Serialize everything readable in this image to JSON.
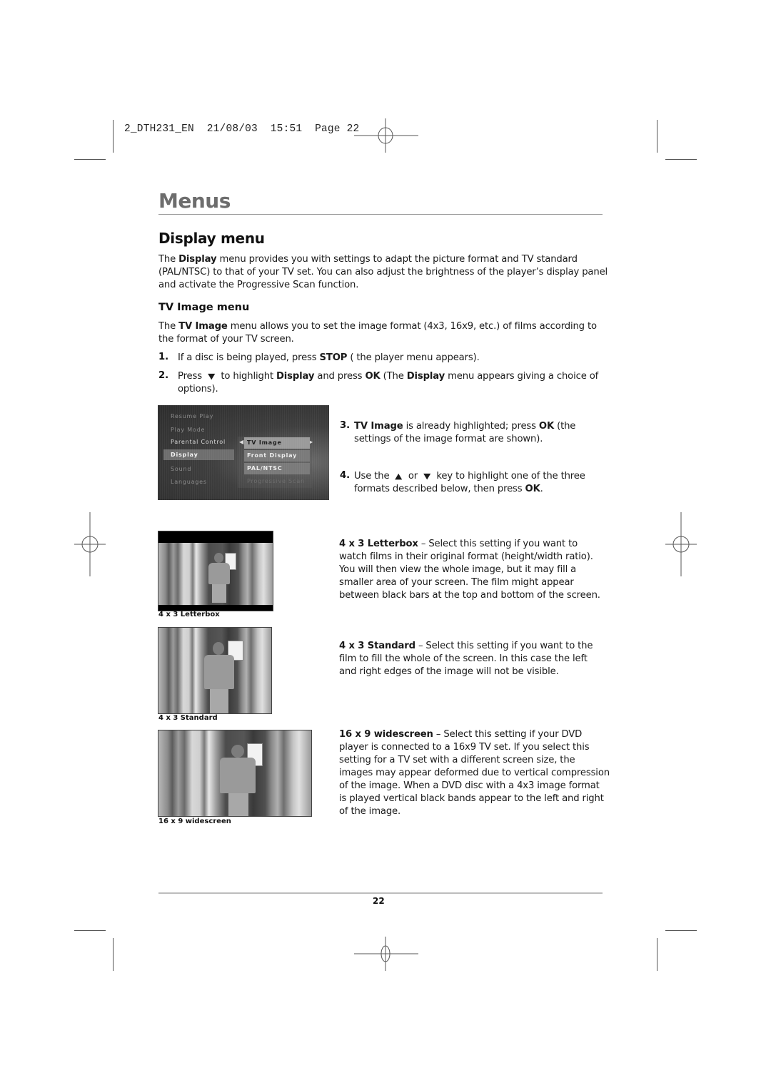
{
  "slug": {
    "file": "2_DTH231_EN",
    "date": "21/08/03",
    "time": "15:51",
    "page_label": "Page 22"
  },
  "chapter_title": "Menus",
  "section_title": "Display menu",
  "intro": {
    "pre": "The ",
    "bold": "Display",
    "line1_rest": " menu provides you with settings to adapt the picture format and TV standard",
    "line2": "(PAL/NTSC) to that of your TV set. You can also adjust the brightness of the player’s display panel",
    "line3": "and activate the Progressive Scan function."
  },
  "subsection_title": "TV Image menu",
  "tv_image_intro": {
    "pre": "The ",
    "bold": "TV Image",
    "line1_rest": " menu allows you to set the image format (4x3, 16x9, etc.) of films according to",
    "line2": "the format of your TV screen."
  },
  "steps": [
    {
      "num": "1.",
      "parts": [
        "If a disc is being played, press ",
        "STOP",
        " ( the player menu appears)."
      ]
    },
    {
      "num": "2.",
      "parts": [
        "Press ",
        "⮟",
        " to highlight ",
        "Display",
        " and press ",
        "OK",
        " (The ",
        "Display",
        " menu appears giving a choice of"
      ],
      "line2": "options)."
    },
    {
      "num": "3.",
      "parts": [
        "TV Image",
        " is already highlighted; press ",
        "OK",
        " (the"
      ],
      "line2": "settings of the image format are shown)."
    },
    {
      "num": "4.",
      "parts": [
        "Use the ",
        "▲",
        " or ",
        "▼",
        " key to highlight one of the three"
      ],
      "line2_pre": "formats described below, then press ",
      "line2_bold": "OK",
      "line2_post": "."
    }
  ],
  "screen_menu": {
    "main_items": [
      "Resume Play",
      "Play Mode",
      "Parental Control",
      "Display",
      "Sound",
      "Languages"
    ],
    "active_item": "Display",
    "sub_items": [
      "TV Image",
      "Front Display",
      "PAL/NTSC",
      "Progressive Scan"
    ],
    "selected_sub_item": "TV Image"
  },
  "formats": [
    {
      "caption": "4 x 3 Letterbox",
      "title": "4 x 3 Letterbox",
      "lines": [
        " – Select this setting if you want to",
        "watch films in their original format (height/width ratio).",
        "You will then view the whole image, but it may fill a",
        "smaller area of your screen. The film might appear",
        "between black bars at the top and bottom of the screen."
      ]
    },
    {
      "caption": "4 x 3 Standard",
      "title": "4 x 3 Standard",
      "lines": [
        " – Select this setting if you want to the",
        "film to fill the whole of the screen. In this case the left",
        "and right edges of the image will not be visible."
      ]
    },
    {
      "caption": "16 x 9 widescreen",
      "title": "16 x 9 widescreen",
      "lines": [
        " – Select this setting if your DVD",
        "player is connected to a 16x9 TV set. If you select this",
        "setting for a TV set with a different screen size, the",
        "images may appear deformed due to vertical compression",
        "of the image. When a DVD disc with a 4x3 image format",
        "is played vertical black bands appear to the left and right",
        "of the image."
      ]
    }
  ],
  "page_number": "22"
}
